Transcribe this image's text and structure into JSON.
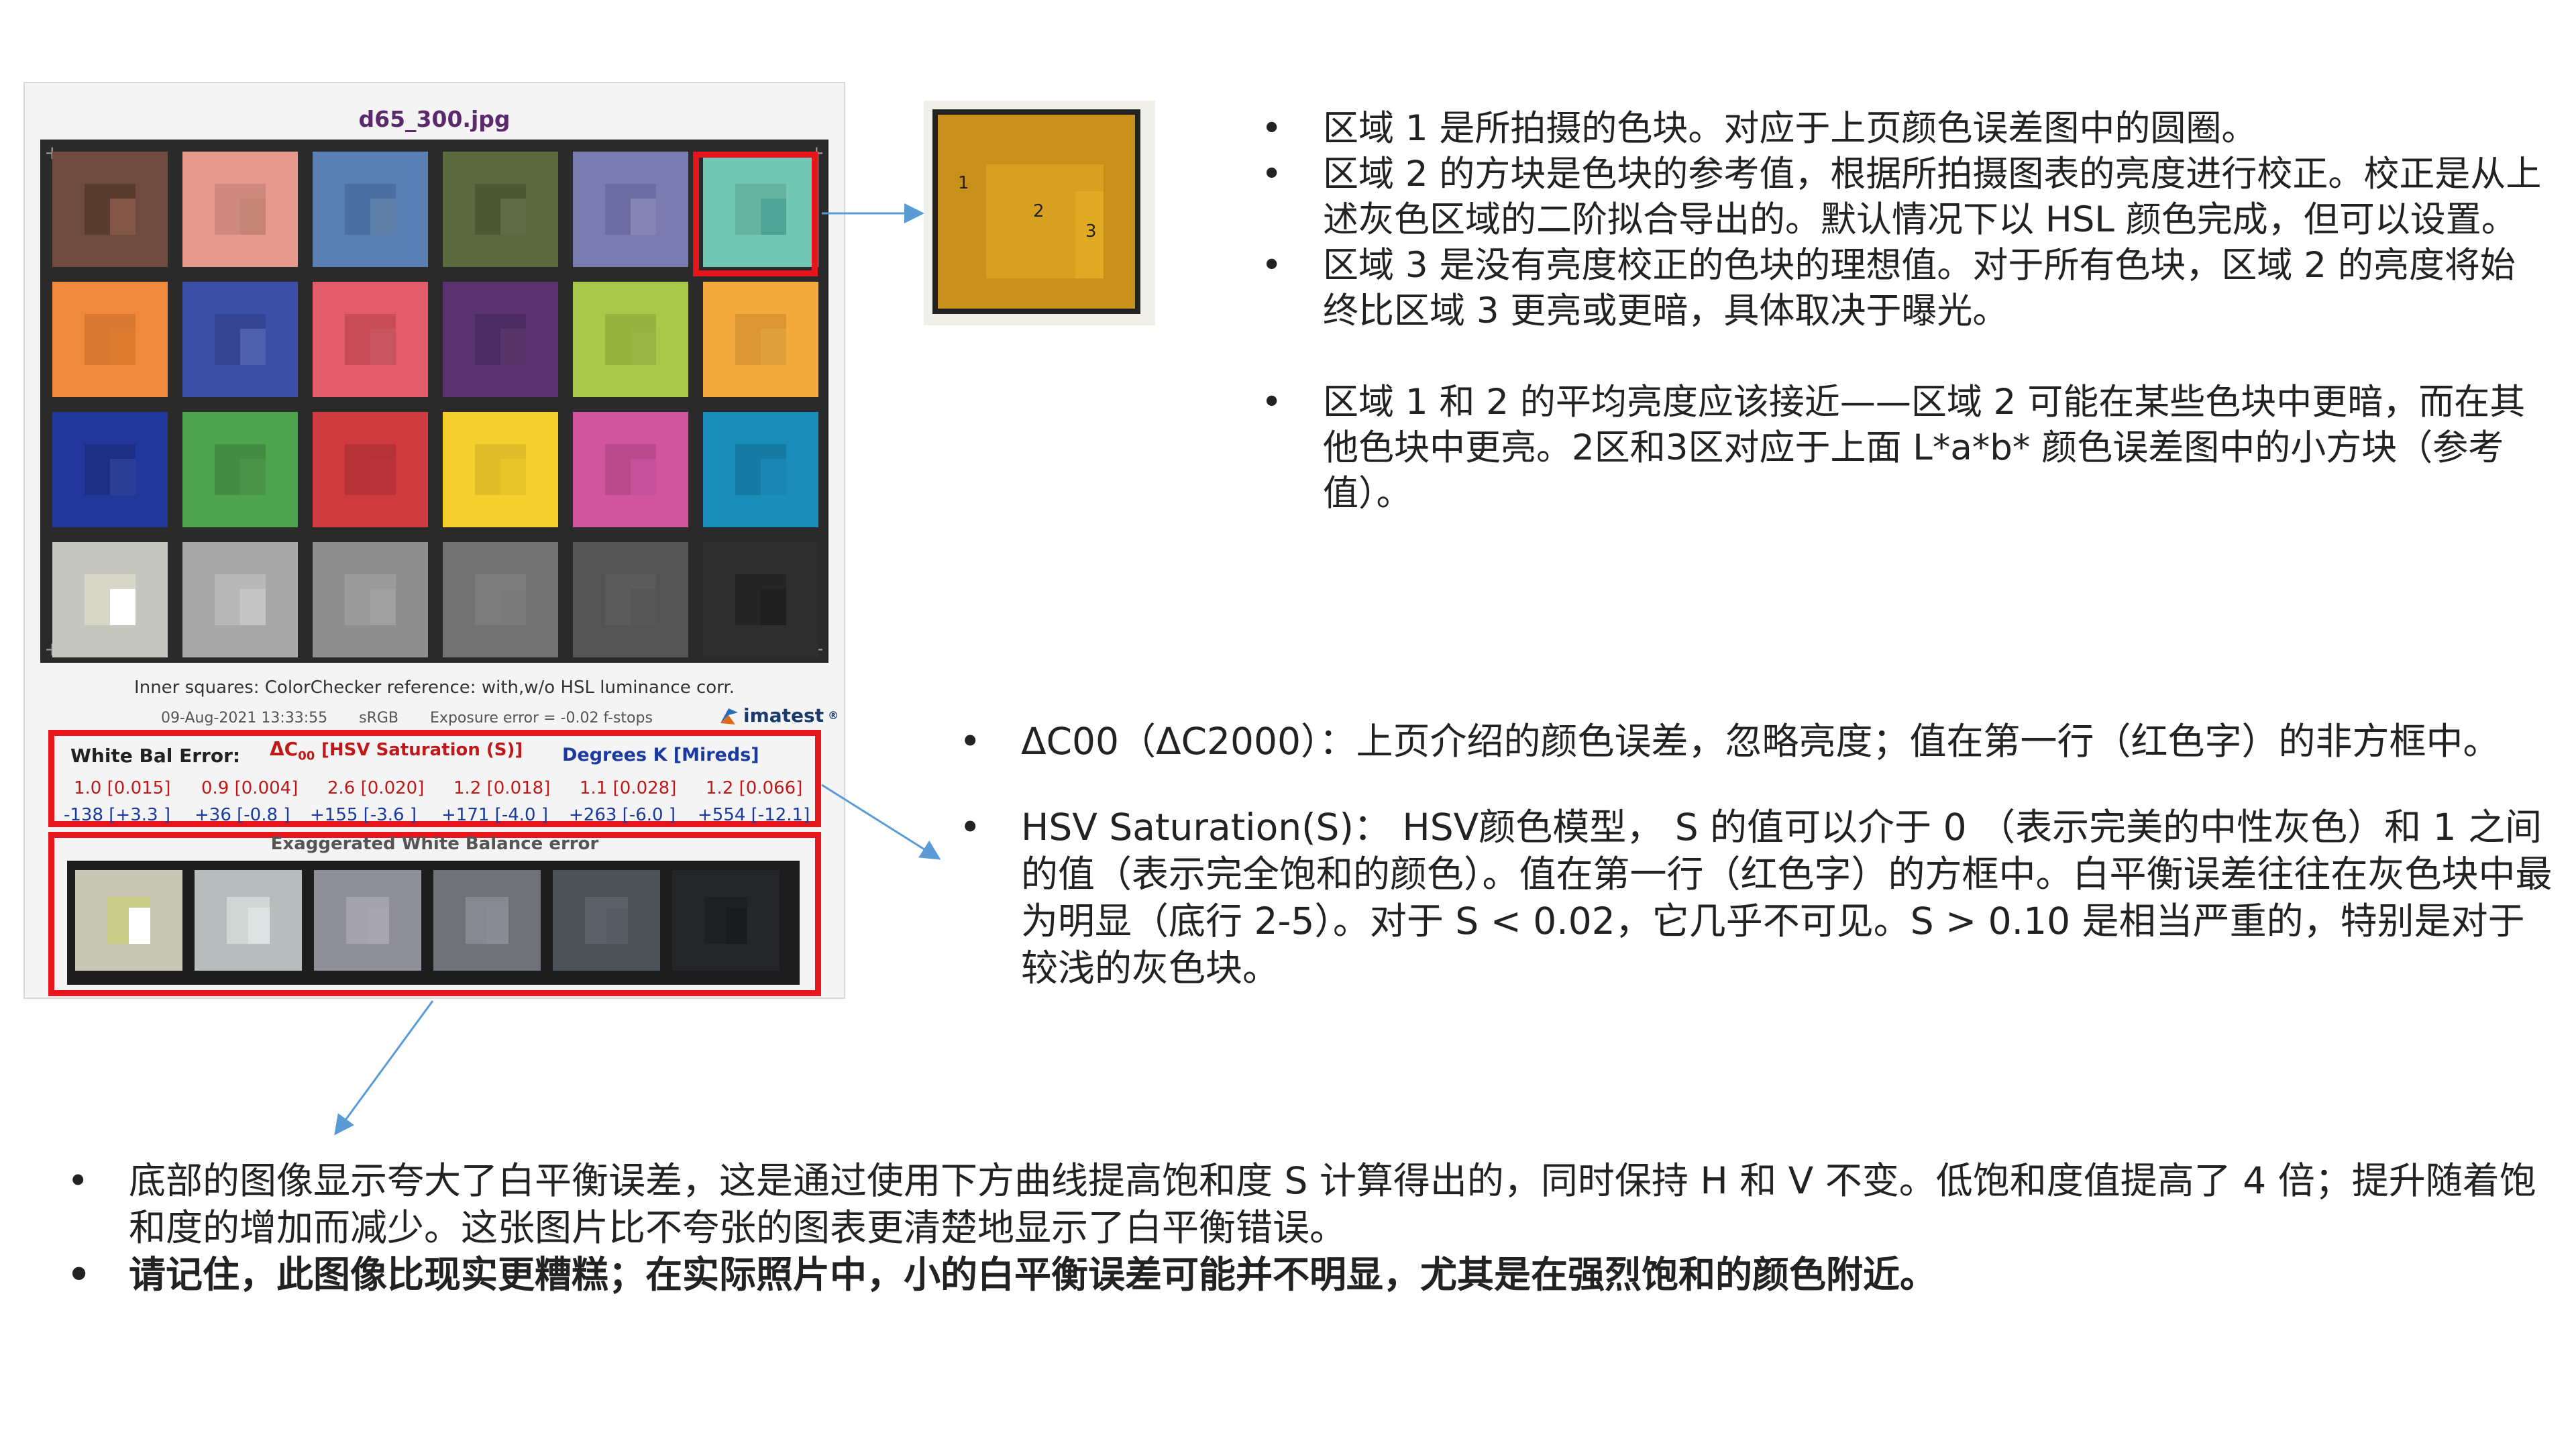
{
  "image_panel": {
    "filename": "d65_300.jpg",
    "inner_caption": "Inner squares: ColorChecker reference: with,w/o HSL luminance corr.",
    "date": "09-Aug-2021 13:33:55",
    "color_space": "sRGB",
    "exposure_error": "Exposure error = -0.02 f-stops",
    "brand": "imatest",
    "brand_mark": "®",
    "brand_icon": "imatest-logo-icon",
    "color_patches": [
      {
        "outer": "#6f4a3f",
        "ref": "#5a3b30",
        "ideal": "#825747"
      },
      {
        "outer": "#e7998e",
        "ref": "#cf8a80",
        "ideal": "#c58474"
      },
      {
        "outer": "#5a7fb4",
        "ref": "#4b6ea3",
        "ideal": "#5e7fa8"
      },
      {
        "outer": "#5b6a3e",
        "ref": "#4b5932",
        "ideal": "#5f6b45"
      },
      {
        "outer": "#7a7bb1",
        "ref": "#6b6ca3",
        "ideal": "#8585b3"
      },
      {
        "outer": "#73c8b5",
        "ref": "#66b3a2",
        "ideal": "#4fa595"
      },
      {
        "outer": "#ef8a3c",
        "ref": "#d87a32",
        "ideal": "#dd7c2e"
      },
      {
        "outer": "#3c4fa6",
        "ref": "#344392",
        "ideal": "#4e60ad"
      },
      {
        "outer": "#e35a68",
        "ref": "#c84d59",
        "ideal": "#c7545f"
      },
      {
        "outer": "#5a3270",
        "ref": "#4b2961",
        "ideal": "#573468"
      },
      {
        "outer": "#a8c84a",
        "ref": "#94b43d",
        "ideal": "#98b444"
      },
      {
        "outer": "#f4a93c",
        "ref": "#dc9533",
        "ideal": "#e0a13a"
      },
      {
        "outer": "#22379b",
        "ref": "#1d2f85",
        "ideal": "#2c3f96"
      },
      {
        "outer": "#4ea34f",
        "ref": "#428d43",
        "ideal": "#4a9449"
      },
      {
        "outer": "#cf3a3f",
        "ref": "#b53236",
        "ideal": "#b93438"
      },
      {
        "outer": "#f3d02c",
        "ref": "#dfbc28",
        "ideal": "#e7c52a"
      },
      {
        "outer": "#d0559e",
        "ref": "#b84a8b",
        "ideal": "#c4529a"
      },
      {
        "outer": "#1a8dbb",
        "ref": "#177aa3",
        "ideal": "#1a86b3"
      },
      {
        "outer": "#c7c7c2",
        "ref": "#d7d7c9",
        "ideal": "#ffffff"
      },
      {
        "outer": "#a8a8a8",
        "ref": "#b8b8b8",
        "ideal": "#c6c6c6"
      },
      {
        "outer": "#8e8e8e",
        "ref": "#9b9b9b",
        "ideal": "#a0a0a0"
      },
      {
        "outer": "#727272",
        "ref": "#7c7c7c",
        "ideal": "#7a7a7a"
      },
      {
        "outer": "#545454",
        "ref": "#5b5b5b",
        "ideal": "#565656"
      },
      {
        "outer": "#2e2e2e",
        "ref": "#252525",
        "ideal": "#1f1f1f"
      }
    ],
    "white_balance": {
      "label": "White Bal Error:",
      "delta_c_label": "ΔC",
      "delta_c_sub": "00",
      "hsv_label": "[HSV Saturation (S)]",
      "degrees_label": "Degrees K [Mireds]",
      "red_row": [
        "1.0 [0.015]",
        "0.9 [0.004]",
        "2.6 [0.020]",
        "1.2 [0.018]",
        "1.1 [0.028]",
        "1.2 [0.066]"
      ],
      "blue_row": [
        "-138 [+3.3 ]",
        "+36 [-0.8 ]",
        "+155 [-3.6 ]",
        "+171 [-4.0 ]",
        "+263 [-6.0 ]",
        "+554 [-12.1]"
      ]
    },
    "exaggerated": {
      "title": "Exaggerated White Balance error",
      "patches": [
        {
          "outer": "#c8c8b4",
          "ref": "#c9cc86",
          "ideal": "#ffffff"
        },
        {
          "outer": "#b7bcbc",
          "ref": "#cfd6d4",
          "ideal": "#dde3e3"
        },
        {
          "outer": "#8f8f99",
          "ref": "#a4a2ad",
          "ideal": "#a9a6b3"
        },
        {
          "outer": "#6f7279",
          "ref": "#878891",
          "ideal": "#8a8c95"
        },
        {
          "outer": "#4b5258",
          "ref": "#5a6168",
          "ideal": "#555c63"
        },
        {
          "outer": "#25262a",
          "ref": "#1f2024",
          "ideal": "#1a1b1e"
        }
      ]
    }
  },
  "zoom_diagram": {
    "labels": [
      "1",
      "2",
      "3"
    ],
    "outer_color": "#c8911c",
    "ref_color": "#d7a020",
    "ideal_color": "#e0aa24"
  },
  "arrow_color": "#5b9bd5",
  "bullet_char": "•",
  "regions_list": [
    "区域 1 是所拍摄的色块。对应于上页颜色误差图中的圆圈。",
    "区域 2 的方块是色块的参考值，根据所拍摄图表的亮度进行校正。校正是从上述灰色区域的二阶拟合导出的。默认情况下以 HSL 颜色完成，但可以设置。",
    "区域 3 是没有亮度校正的色块的理想值。对于所有色块，区域 2 的亮度将始终比区域 3 更亮或更暗，具体取决于曝光。",
    "区域 1 和 2 的平均亮度应该接近——区域 2 可能在某些色块中更暗，而在其他色块中更亮。2区和3区对应于上面 L*a*b* 颜色误差图中的小方块（参考值）。"
  ],
  "terms_list": [
    "ΔC00（ΔC2000）：上页介绍的颜色误差，忽略亮度；值在第一行（红色字）的非方框中。",
    "HSV Saturation(S)： HSV颜色模型， S 的值可以介于 0 （表示完美的中性灰色）和 1 之间的值（表示完全饱和的颜色）。值在第一行（红色字）的方框中。白平衡误差往往在灰色块中最为明显（底行 2-5）。对于 S < 0.02，它几乎不可见。S > 0.10 是相当严重的，特别是对于较浅的灰色块。"
  ],
  "bottom_list": [
    "底部的图像显示夸大了白平衡误差，这是通过使用下方曲线提高饱和度 S 计算得出的，同时保持 H 和 V 不变。低饱和度值提高了 4 倍；提升随着饱和度的增加而减少。这张图片比不夸张的图表更清楚地显示了白平衡错误。",
    "请记住，此图像比现实更糟糕；在实际照片中，小的白平衡误差可能并不明显，尤其是在强烈饱和的颜色附近。"
  ]
}
